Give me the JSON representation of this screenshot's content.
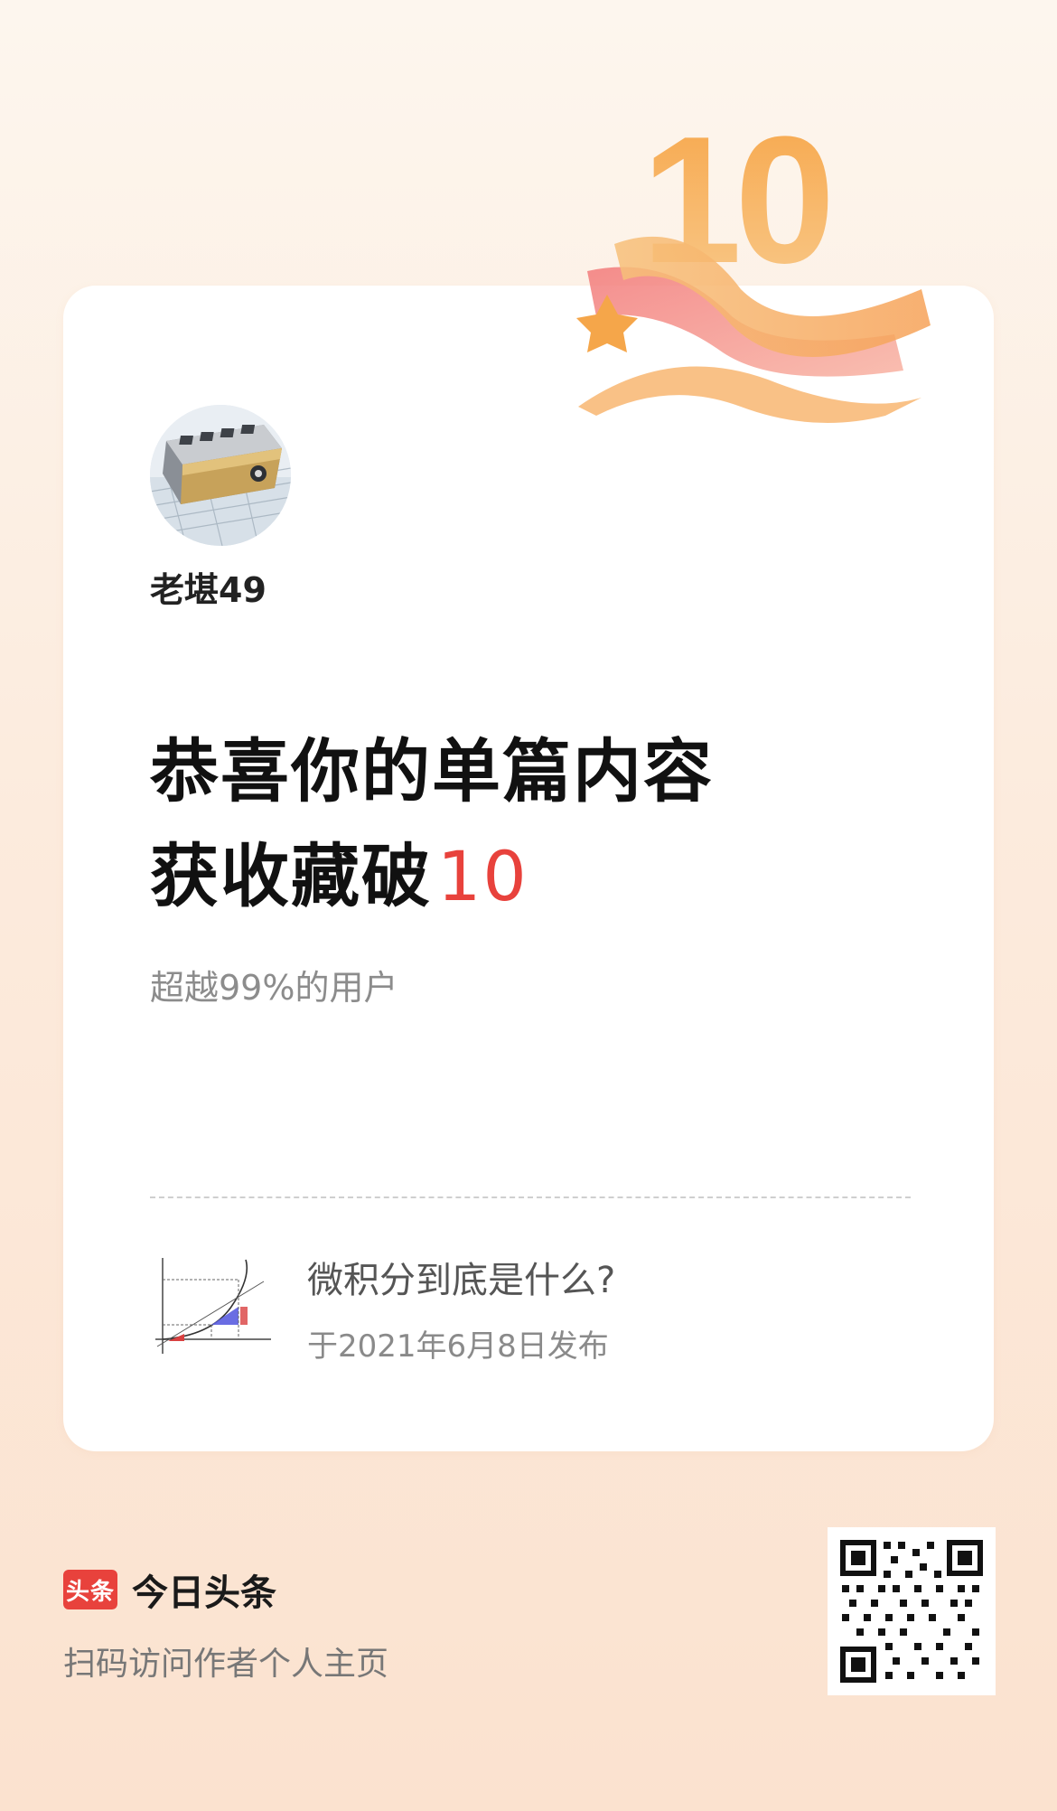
{
  "card": {
    "author_name": "老堪49",
    "headline_line1": "恭喜你的单篇内容",
    "headline_line2": "获收藏破",
    "headline_number": "10",
    "subline": "超越99%的用户",
    "article": {
      "title": "微积分到底是什么?",
      "date": "于2021年6月8日发布"
    }
  },
  "badge": {
    "number": "10"
  },
  "footer": {
    "brand_logo": "头条",
    "brand_name": "今日头条",
    "scan_hint": "扫码访问作者个人主页"
  },
  "colors": {
    "accent": "#e8423c",
    "badge_orange": "#f3963f",
    "badge_pink": "#f48a8a"
  }
}
